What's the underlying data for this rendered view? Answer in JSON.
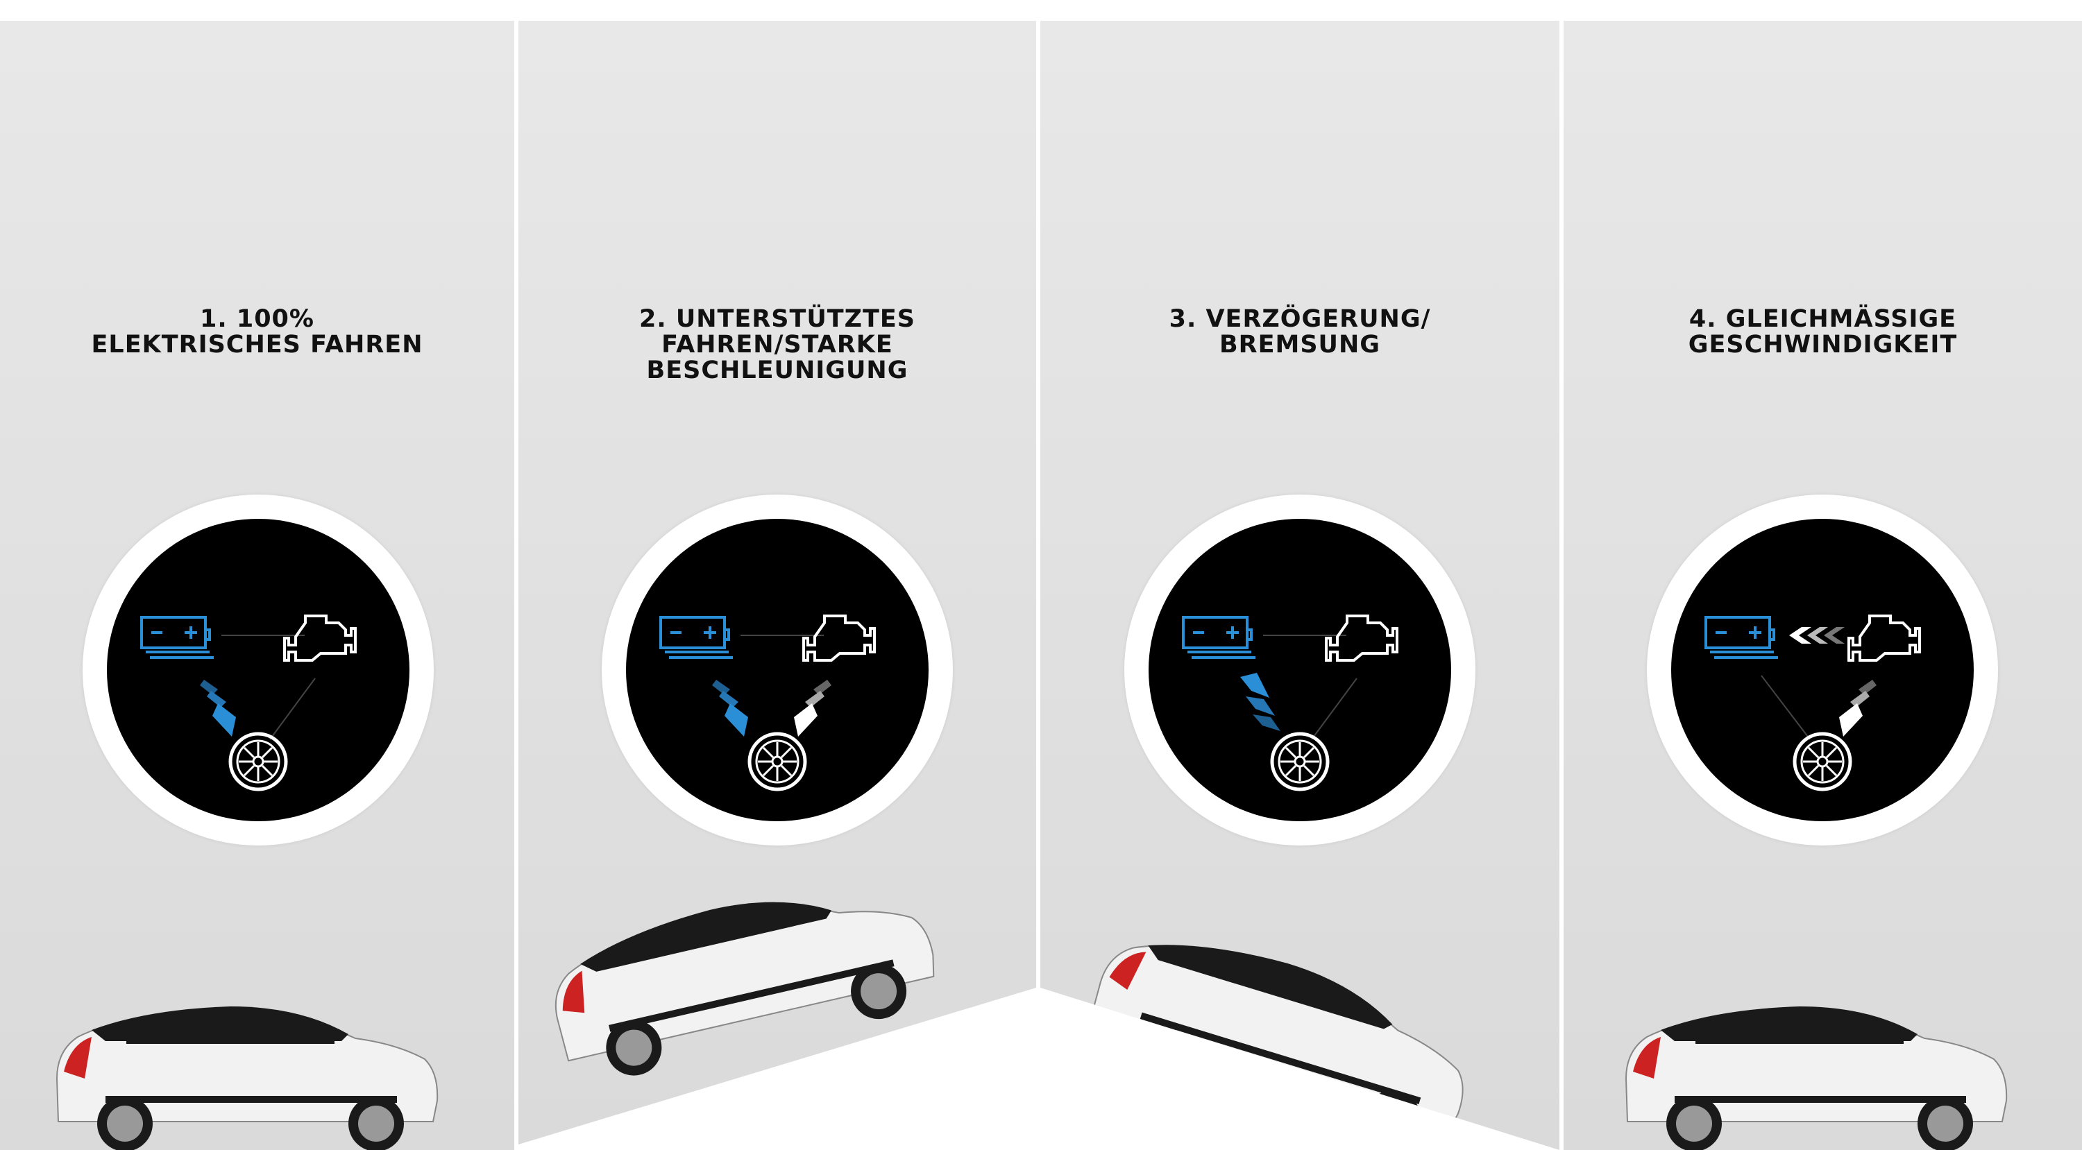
{
  "panels": [
    {
      "title_line1": "1. 100%",
      "title_line2": "ELEKTRISCHES FAHREN",
      "title_line3": ""
    },
    {
      "title_line1": "2. UNTERSTÜTZTES",
      "title_line2": "FAHREN/STARKE",
      "title_line3": "BESCHLEUNIGUNG"
    },
    {
      "title_line1": "3. VERZÖGERUNG/",
      "title_line2": "BREMSUNG",
      "title_line3": ""
    },
    {
      "title_line1": "4. GLEICHMÄSSIGE",
      "title_line2": "GESCHWINDIGKEIT",
      "title_line3": ""
    }
  ],
  "icons": {
    "battery": "battery-icon",
    "engine": "engine-icon",
    "wheel": "wheel-icon",
    "chevrons": "chevron-arrows-icon",
    "car": "car-icon"
  },
  "colors": {
    "electric_blue": "#2a8fd6",
    "combustion_white": "#ffffff",
    "disc": "#000000",
    "panel_bg": "#e4e4e4"
  }
}
